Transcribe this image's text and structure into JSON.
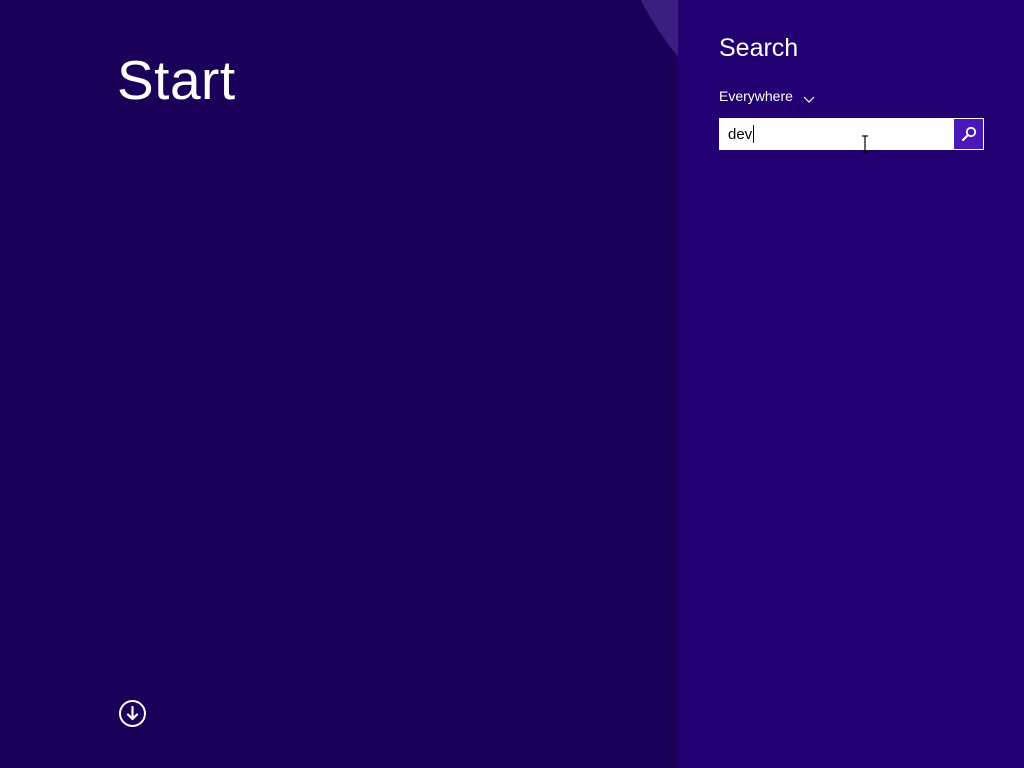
{
  "start": {
    "title": "Start",
    "all_apps_icon": "arrow-down-circle-icon"
  },
  "search_pane": {
    "heading": "Search",
    "scope": {
      "selected": "Everywhere",
      "icon": "chevron-down-icon"
    },
    "input": {
      "value": "dev"
    },
    "search_button_icon": "magnifier-icon"
  },
  "colors": {
    "start_background": "#1b0059",
    "search_pane_background": "#220071",
    "background_arc": "#3a1e80",
    "search_button": "#4a17b8",
    "text": "#ffffff"
  }
}
